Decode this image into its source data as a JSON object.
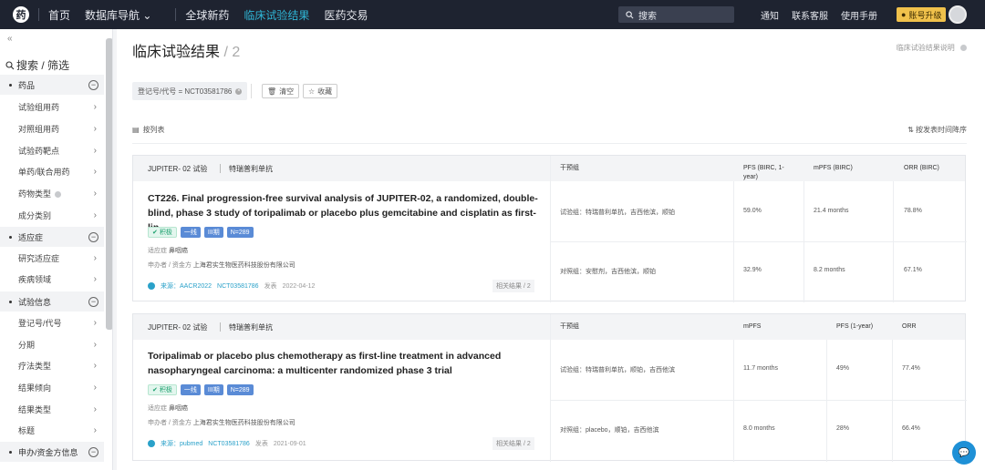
{
  "nav": {
    "logo": "药",
    "items": [
      "首页",
      "数据库导航 ⌄",
      "全球新药",
      "临床试验结果",
      "医药交易"
    ],
    "search_placeholder": "搜索",
    "right": [
      "通知",
      "联系客服",
      "使用手册"
    ],
    "upgrade": "账号升级"
  },
  "sidebar": {
    "collapse": "«",
    "title": "搜索 / 筛选",
    "groups": [
      {
        "label": "药品",
        "items": [
          "试验组用药",
          "对照组用药",
          "试验药靶点",
          "单药/联合用药",
          "药物类型",
          "成分类别"
        ]
      },
      {
        "label": "适应症",
        "items": [
          "研究适应症",
          "疾病领域"
        ]
      },
      {
        "label": "试验信息",
        "items": [
          "登记号/代号",
          "分期",
          "疗法类型",
          "结果倾向",
          "结果类型",
          "标题"
        ]
      },
      {
        "label": "申办/资金方信息",
        "items": []
      }
    ]
  },
  "main": {
    "title": "临床试验结果",
    "count": "/ 2",
    "help": "临床试验结果说明",
    "filter_tag": "登记号/代号 = NCT03581786",
    "clear": "清空",
    "save": "收藏",
    "list_label": "按列表",
    "sort": "按发表时间降序"
  },
  "cards": [
    {
      "trial": "JUPITER- 02 试验",
      "drug": "特瑞普利单抗",
      "columns": [
        "干预组",
        "PFS (BIRC, 1-year)",
        "mPFS (BIRC)",
        "ORR (BIRC)"
      ],
      "title": "CT226. Final progression-free survival analysis of JUPITER-02, a randomized, double-blind, phase 3 study of toripalimab or placebo plus gemcitabine and cisplatin as first-lin...",
      "badges": [
        "积极",
        "一线",
        "III期",
        "N=289"
      ],
      "indication_label": "适应症",
      "indication": "鼻咽癌",
      "sponsor_label": "申办者 / 资金方",
      "sponsor": "上海君实生物医药科技股份有限公司",
      "source": "来源：AACR2022",
      "nct": "NCT03581786",
      "pub_label": "发表",
      "date": "2022-04-12",
      "related": "相关结果 / 2",
      "rows": [
        [
          "试验组：特瑞普利单抗，吉西他滨，顺铂",
          "59.0%",
          "21.4 months",
          "78.8%"
        ],
        [
          "对照组：安慰剂，吉西他滨，顺铂",
          "32.9%",
          "8.2 months",
          "67.1%"
        ]
      ]
    },
    {
      "trial": "JUPITER- 02 试验",
      "drug": "特瑞普利单抗",
      "columns": [
        "干预组",
        "mPFS",
        "PFS (1-year)",
        "ORR"
      ],
      "title": "Toripalimab or placebo plus chemotherapy as first-line treatment in advanced nasopharyngeal carcinoma: a multicenter randomized phase 3 trial",
      "badges": [
        "积极",
        "一线",
        "III期",
        "N=289"
      ],
      "indication_label": "适应症",
      "indication": "鼻咽癌",
      "sponsor_label": "申办者 / 资金方",
      "sponsor": "上海君实生物医药科技股份有限公司",
      "source": "来源：pubmed",
      "nct": "NCT03581786",
      "pub_label": "发表",
      "date": "2021-09-01",
      "related": "相关结果 / 2",
      "rows": [
        [
          "试验组：特瑞普利单抗，顺铂，吉西他滨",
          "11.7 months",
          "49%",
          "77.4%"
        ],
        [
          "对照组：placebo，顺铂，吉西他滨",
          "8.0 months",
          "28%",
          "66.4%"
        ]
      ]
    }
  ]
}
